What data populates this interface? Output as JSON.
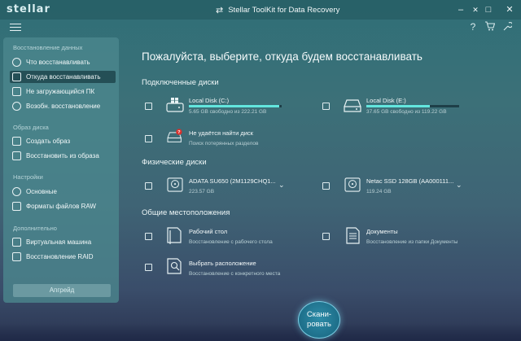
{
  "window": {
    "logo": "stellar",
    "title": "Stellar ToolKit for Data Recovery",
    "controls": [
      "✕",
      "–",
      "☐",
      "✕"
    ]
  },
  "toolbar": {
    "help_icon": "?",
    "cart_icon": "cart-icon",
    "extra_icon": "key-icon"
  },
  "sidebar": {
    "sections": [
      {
        "title": "Восстановление данных",
        "items": [
          "Что восстанавливать",
          "Откуда восстанавливать",
          "Не загружающийся ПК",
          "Возобн. восстановление"
        ]
      },
      {
        "title": "Образ диска",
        "items": [
          "Создать образ",
          "Восстановить из образа"
        ]
      },
      {
        "title": "Настройки",
        "items": [
          "Основные",
          "Форматы файлов RAW"
        ]
      },
      {
        "title": "Дополнительно",
        "items": [
          "Виртуальная машина",
          "Восстановление RAID"
        ]
      }
    ],
    "upgrade_label": "Апгрейд"
  },
  "main": {
    "title": "Пожалуйста, выберите, откуда будем восстанавливать",
    "connected": {
      "title": "Подключенные диски",
      "drives": [
        {
          "name": "Local Disk (C:)",
          "sub": "5.65 GB свободно из 222.21 GB",
          "used_fraction": 0.97
        },
        {
          "name": "Local Disk (E:)",
          "sub": "37.65 GB свободно из 119.22 GB",
          "used_fraction": 0.68
        },
        {
          "name": "Не удаётся найти диск",
          "sub": "Поиск потерянных разделов"
        }
      ]
    },
    "physical": {
      "title": "Физические диски",
      "drives": [
        {
          "name": "ADATA SU650 (2M1129CHQ1...",
          "sub": "223.57 GB"
        },
        {
          "name": "Netac SSD 128GB (AA000111...",
          "sub": "119.24 GB"
        }
      ]
    },
    "common": {
      "title": "Общие местоположения",
      "items": [
        {
          "name": "Рабочий стол",
          "sub": "Восстановление с рабочего стола"
        },
        {
          "name": "Документы",
          "sub": "Восстановление из папки Документы"
        },
        {
          "name": "Выбрать расположение",
          "sub": "Восстановление с конкретного места"
        }
      ]
    }
  },
  "scan": {
    "line1": "Скани-",
    "line2": "ровать"
  },
  "colors": {
    "accent": "#63e6de",
    "error_badge": "#d9302c"
  }
}
